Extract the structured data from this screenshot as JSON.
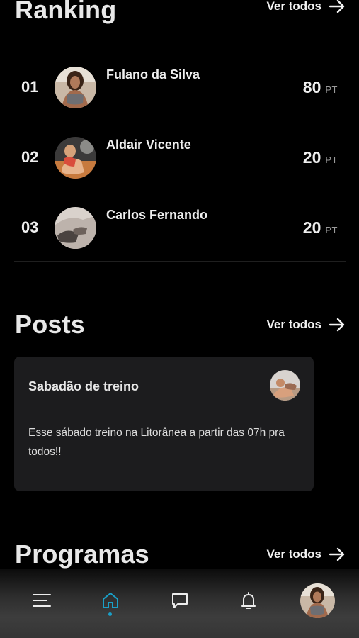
{
  "ranking": {
    "title": "Ranking",
    "see_all": "Ver todos",
    "rows": [
      {
        "position": "01",
        "name": "Fulano da Silva",
        "points": "80",
        "unit": "PT"
      },
      {
        "position": "02",
        "name": "Aldair Vicente",
        "points": "20",
        "unit": "PT"
      },
      {
        "position": "03",
        "name": "Carlos Fernando",
        "points": "20",
        "unit": "PT"
      }
    ]
  },
  "posts": {
    "title": "Posts",
    "see_all": "Ver todos",
    "items": [
      {
        "title": "Sabadão de treino",
        "body": "Esse sábado treino na Litorânea a partir das 07h pra todos!!"
      }
    ]
  },
  "programs": {
    "title": "Programas",
    "see_all": "Ver todos"
  },
  "tabbar": {
    "active_tab": "home",
    "active_color": "#1aa0c8",
    "icons": [
      "menu-icon",
      "home-icon",
      "chat-icon",
      "bell-icon",
      "profile-avatar"
    ]
  }
}
